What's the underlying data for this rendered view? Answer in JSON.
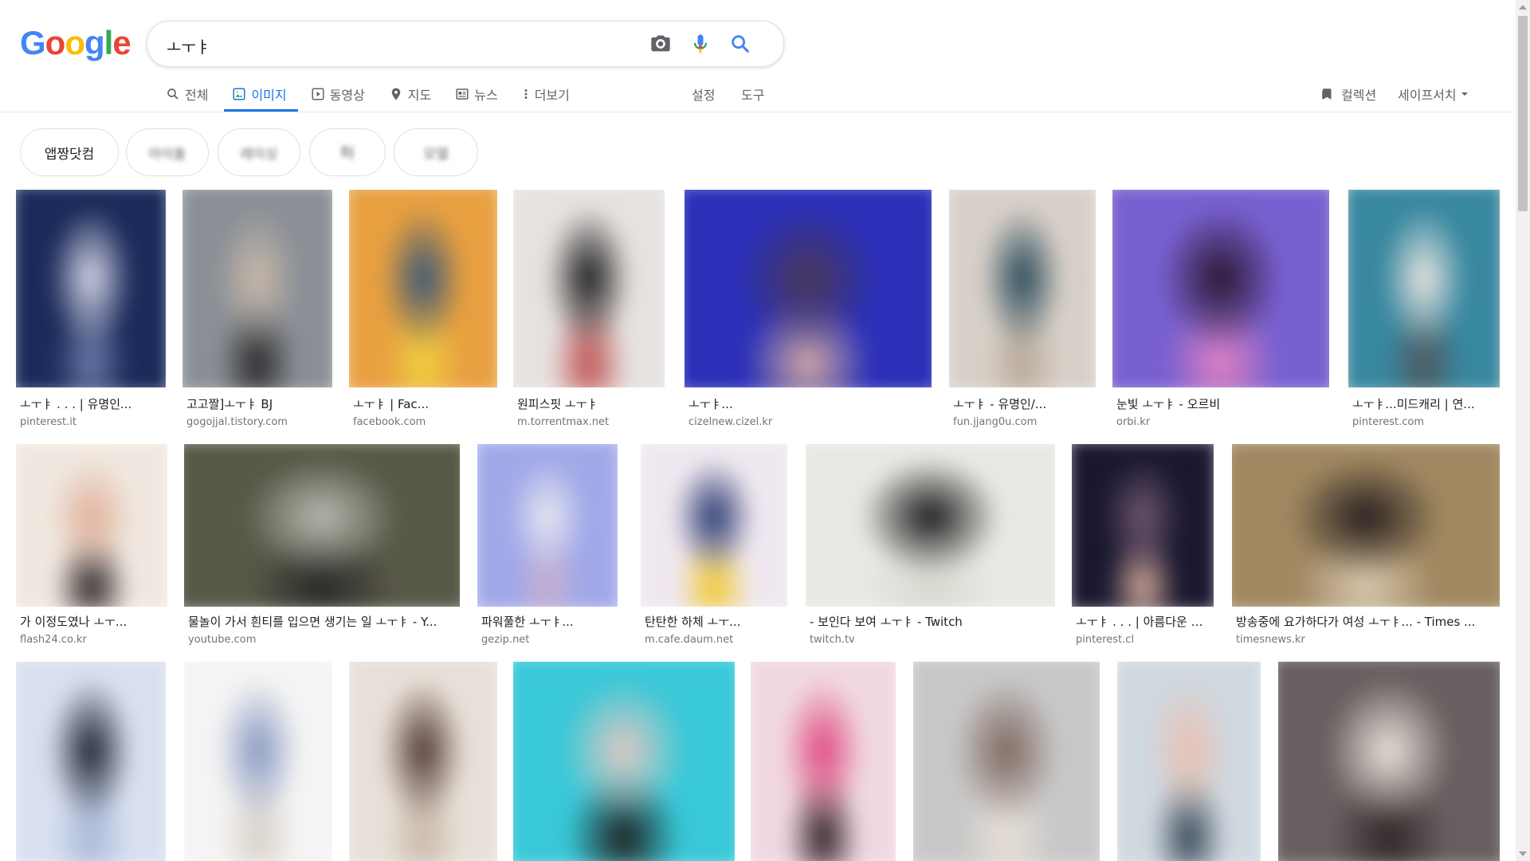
{
  "search": {
    "query": "ㅗㅜㅑ"
  },
  "logo_text": [
    "G",
    "o",
    "o",
    "g",
    "l",
    "e"
  ],
  "logo_colors": [
    "#4285f4",
    "#ea4335",
    "#fbbc05",
    "#4285f4",
    "#34a853",
    "#ea4335"
  ],
  "tabs": [
    {
      "label": "전체",
      "icon": "search-icon"
    },
    {
      "label": "이미지",
      "icon": "image-icon",
      "active": true
    },
    {
      "label": "동영상",
      "icon": "video-icon"
    },
    {
      "label": "지도",
      "icon": "map-pin-icon"
    },
    {
      "label": "뉴스",
      "icon": "news-icon"
    },
    {
      "label": "더보기",
      "icon": "more-vert-icon"
    }
  ],
  "settings_label": "설정",
  "tools_label": "도구",
  "collections_label": "컬렉션",
  "safesearch_label": "세이프서치",
  "chips": [
    {
      "label": "앱짱닷컴"
    },
    {
      "label": "아이돌"
    },
    {
      "label": "레이싱"
    },
    {
      "label": "BJ"
    },
    {
      "label": "모델"
    }
  ],
  "results_row1": [
    {
      "caption": "ㅗㅜㅑ . . . | 유명인...",
      "source": "pinterest.it",
      "colors": [
        "#1b2a5a",
        "#d8d8e8",
        "#6b7aa8"
      ]
    },
    {
      "caption": "고고짤]ㅗㅜㅑ BJ",
      "source": "gogojjal.tistory.com",
      "colors": [
        "#8a8f96",
        "#c9b9a9",
        "#2b2b2b"
      ]
    },
    {
      "caption": "ㅗㅜㅑ | Fac...",
      "source": "facebook.com",
      "colors": [
        "#e8a040",
        "#3a5878",
        "#f0d040"
      ]
    },
    {
      "caption": "원피스핏 ㅗㅜㅑ",
      "source": "m.torrentmax.net",
      "colors": [
        "#e6e2e0",
        "#1a1a1a",
        "#c05050"
      ]
    },
    {
      "caption": "ㅗㅜㅑ...",
      "source": "cizelnew.cizel.kr",
      "colors": [
        "#2a30b8",
        "#4a3858",
        "#d0a8a0"
      ]
    },
    {
      "caption": "ㅗㅜㅑ - 유명인/...",
      "source": "fun.jjang0u.com",
      "colors": [
        "#d8d0c8",
        "#284858",
        "#b8a898"
      ]
    },
    {
      "caption": "눈빛 ㅗㅜㅑ - 오르비",
      "source": "orbi.kr",
      "colors": [
        "#7860d0",
        "#2a1830",
        "#e080c0"
      ]
    },
    {
      "caption": "ㅗㅜㅑ...미드캐리 | 연...",
      "source": "pinterest.com",
      "colors": [
        "#3888a0",
        "#e8e4e0",
        "#505860"
      ]
    }
  ],
  "results_row2": [
    {
      "caption": "가 이정도였나 ㅗㅜ...",
      "source": "flash24.co.kr",
      "colors": [
        "#f0e8e0",
        "#e0b098",
        "#302828"
      ]
    },
    {
      "caption": "물놀이 가서 흰티를 입으면 생기는 일 ㅗㅜㅑ - Y...",
      "source": "youtube.com",
      "colors": [
        "#585848",
        "#b8b8b0",
        "#2a2828"
      ]
    },
    {
      "caption": "파워풀한 ㅗㅜㅑ...",
      "source": "gezip.net",
      "colors": [
        "#a0a8e8",
        "#e8e8f0",
        "#c8b0d0"
      ]
    },
    {
      "caption": "탄탄한 하체 ㅗㅜ...",
      "source": "m.cafe.daum.net",
      "colors": [
        "#f0e8f0",
        "#283870",
        "#f0c830"
      ]
    },
    {
      "caption": "- 보인다 보여 ㅗㅜㅑ - Twitch",
      "source": "twitch.tv",
      "colors": [
        "#e8e8e4",
        "#1a1a1a",
        "#d8d8d0"
      ]
    },
    {
      "caption": "ㅗㅜㅑ . . . | 아름다운 여...",
      "source": "pinterest.cl",
      "colors": [
        "#1a1830",
        "#705870",
        "#d0a898"
      ]
    },
    {
      "caption": "방송중에 요가하다가 여성 ㅗㅜㅑ... - Times ...",
      "source": "timesnews.kr",
      "colors": [
        "#a08860",
        "#282020",
        "#d8c8b0"
      ]
    }
  ],
  "results_row3": [
    {
      "colors": [
        "#d8e0f0",
        "#1a2030",
        "#a8b8d8"
      ]
    },
    {
      "colors": [
        "#f4f4f4",
        "#8898c0",
        "#d8d0c8"
      ]
    },
    {
      "colors": [
        "#e8e0d8",
        "#503830",
        "#c8b8a8"
      ]
    },
    {
      "colors": [
        "#38c8d8",
        "#e0c8c0",
        "#202020"
      ]
    },
    {
      "colors": [
        "#f0d8e0",
        "#e04880",
        "#302028"
      ]
    },
    {
      "colors": [
        "#c8c8c8",
        "#806860",
        "#e8e0d8"
      ]
    },
    {
      "colors": [
        "#d0d8e0",
        "#e8c0b0",
        "#384858"
      ]
    },
    {
      "colors": [
        "#686060",
        "#e8e0d8",
        "#302828"
      ]
    }
  ]
}
